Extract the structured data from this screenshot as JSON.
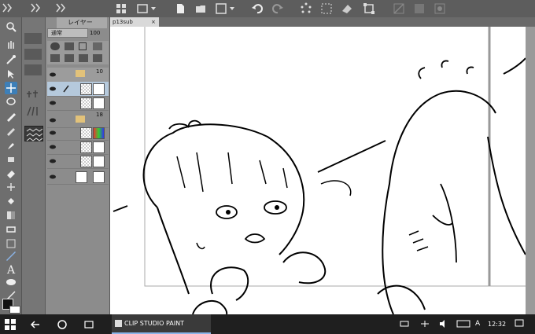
{
  "toolbar": {
    "icons": [
      "menu-grid-icon",
      "camera-dropdown-icon",
      "new-file-icon",
      "open-file-icon",
      "save-icon",
      "undo-icon",
      "redo-icon",
      "select-scatter-icon",
      "select-all-icon",
      "clear-icon",
      "fill-icon",
      "transform-icon",
      "disabled-a-icon",
      "disabled-b-icon",
      "disabled-c-icon"
    ]
  },
  "layer_panel": {
    "tab_label": "レイヤー",
    "blend_mode": "通常",
    "opacity": "100",
    "folder1_count": "10",
    "folder2_count": "18"
  },
  "document": {
    "tab_title": "p13sub"
  },
  "taskbar": {
    "app_label": "CLIP STUDIO PAINT",
    "time": "12:32",
    "ime": "A"
  },
  "colors": {
    "toolbar_bg": "#5d5d5d",
    "panel_bg": "#8c8c8c",
    "selection_blue": "#3d7fb8",
    "taskbar_bg": "#1f1f1f"
  }
}
